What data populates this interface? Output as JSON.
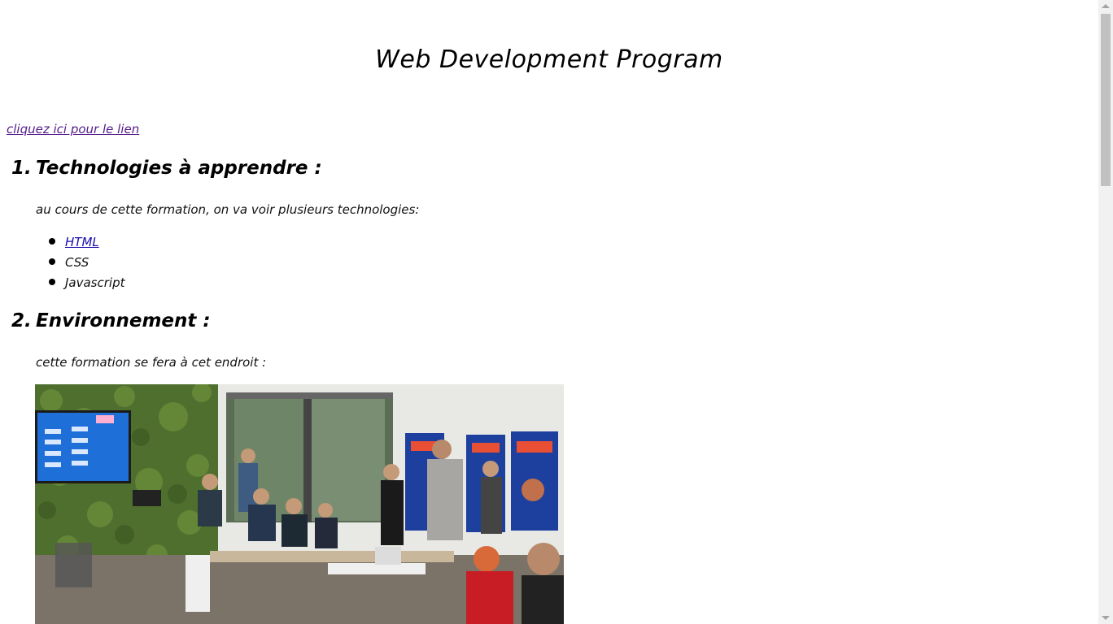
{
  "page": {
    "title": "Web Development Program",
    "link_text": "cliquez ici pour le lien"
  },
  "section1": {
    "number": "1.",
    "heading": "Technologies à apprendre :",
    "intro": "au cours de cette formation, on va voir plusieurs technologies:",
    "items": [
      {
        "label": "HTML",
        "is_link": true
      },
      {
        "label": "CSS",
        "is_link": false
      },
      {
        "label": "Javascript",
        "is_link": false
      }
    ]
  },
  "section2": {
    "number": "2.",
    "heading": "Environnement :",
    "intro": "cette formation se fera à cet endroit :"
  },
  "colors": {
    "visited_link": "#551a8b",
    "link": "#1a0dab",
    "text": "#000000",
    "scrollbar_track": "#f1f1f1",
    "scrollbar_thumb": "#c1c1c1"
  }
}
